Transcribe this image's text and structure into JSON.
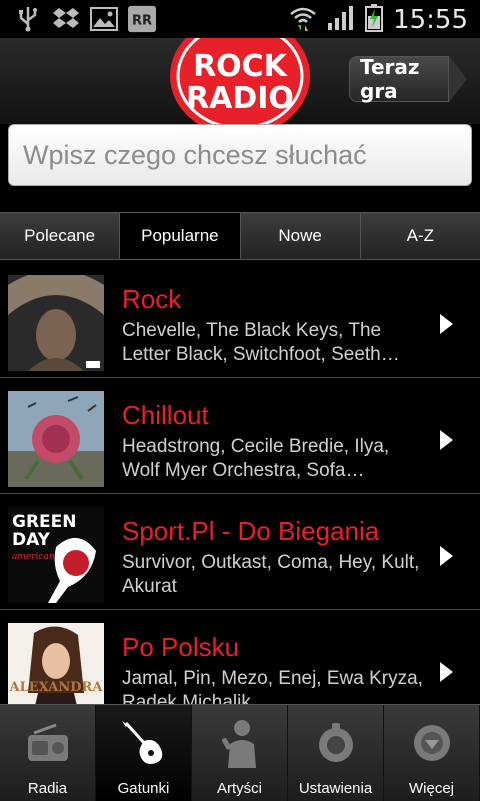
{
  "status_bar": {
    "time": "15:55",
    "icons": [
      "usb-icon",
      "dropbox-icon",
      "gallery-icon",
      "rr-icon",
      "wifi-icon",
      "signal-icon",
      "battery-icon"
    ],
    "rr_label": "RR"
  },
  "header": {
    "logo_line1": "ROCK",
    "logo_line2": "RADIO",
    "now_playing_label": "Teraz gra"
  },
  "search": {
    "placeholder": "Wpisz czego chcesz słuchać"
  },
  "tabs": [
    {
      "label": "Polecane",
      "active": false
    },
    {
      "label": "Popularne",
      "active": true
    },
    {
      "label": "Nowe",
      "active": false
    },
    {
      "label": "A-Z",
      "active": false
    }
  ],
  "list": [
    {
      "title": "Rock",
      "desc": "Chevelle, The Black Keys, The Letter Black, Switchfoot, Seeth…"
    },
    {
      "title": "Chillout",
      "desc": "Headstrong, Cecile Bredie, Ilya, Wolf Myer Orchestra, Sofa…"
    },
    {
      "title": "Sport.Pl - Do Biegania",
      "desc": "Survivor, Outkast, Coma, Hey, Kult, Akurat",
      "thumb_text1": "GREEN",
      "thumb_text2": "DAY",
      "thumb_text3": "american idiot"
    },
    {
      "title": "Po Polsku",
      "desc": "Jamal, Pin, Mezo, Enej, Ewa Kryza, Radek Michalik",
      "thumb_text1": "ALEXANDRA"
    }
  ],
  "bottom_nav": [
    {
      "label": "Radia",
      "icon": "radio-icon",
      "active": false
    },
    {
      "label": "Gatunki",
      "icon": "guitar-icon",
      "active": true
    },
    {
      "label": "Artyści",
      "icon": "singer-icon",
      "active": false
    },
    {
      "label": "Ustawienia",
      "icon": "settings-icon",
      "active": false
    },
    {
      "label": "Więcej",
      "icon": "more-icon",
      "active": false
    }
  ],
  "colors": {
    "accent_red": "#e8202a",
    "background": "#000000"
  }
}
